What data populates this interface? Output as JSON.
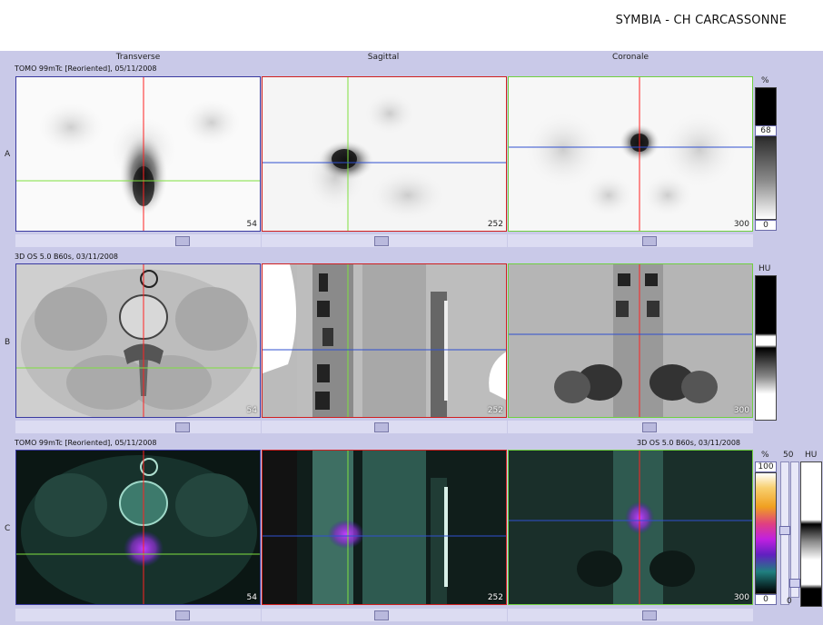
{
  "header": {
    "title": "SYMBIA - CH CARCASSONNE"
  },
  "columns": {
    "transverse": "Transverse",
    "sagittal": "Sagittal",
    "coronal": "Coronale"
  },
  "rows": {
    "a": {
      "letter": "A",
      "series": "TOMO 99mTc [Reoriented], 05/11/2008",
      "slices": {
        "transverse": "54",
        "sagittal": "252",
        "coronal": "300"
      }
    },
    "b": {
      "letter": "B",
      "series": "3D  OS  5.0  B60s, 03/11/2008",
      "slices": {
        "transverse": "54",
        "sagittal": "252",
        "coronal": "300"
      }
    },
    "c": {
      "letter": "C",
      "series_left": "TOMO 99mTc [Reoriented], 05/11/2008",
      "series_right": "3D  OS  5.0  B60s, 03/11/2008",
      "slices": {
        "transverse": "54",
        "sagittal": "252",
        "coronal": "300"
      }
    }
  },
  "scales": {
    "a": {
      "unit": "%",
      "level": "68",
      "min": "0"
    },
    "b": {
      "unit": "HU"
    },
    "c": {
      "pct_unit": "%",
      "pct_max": "100",
      "pct_min": "0",
      "fifty": "50",
      "hu_unit": "HU",
      "hu_min": "0"
    }
  },
  "colors": {
    "crosshair_vertical_a": "#ff2222",
    "crosshair_horizontal_transverse": "#7fe040",
    "crosshair_horizontal_other": "#3050d0",
    "border_transverse": "#3a3aa0",
    "border_sagittal": "#d02020",
    "border_coronal": "#70d040"
  },
  "icons": {
    "scroll_thumb": "slider-thumb"
  }
}
